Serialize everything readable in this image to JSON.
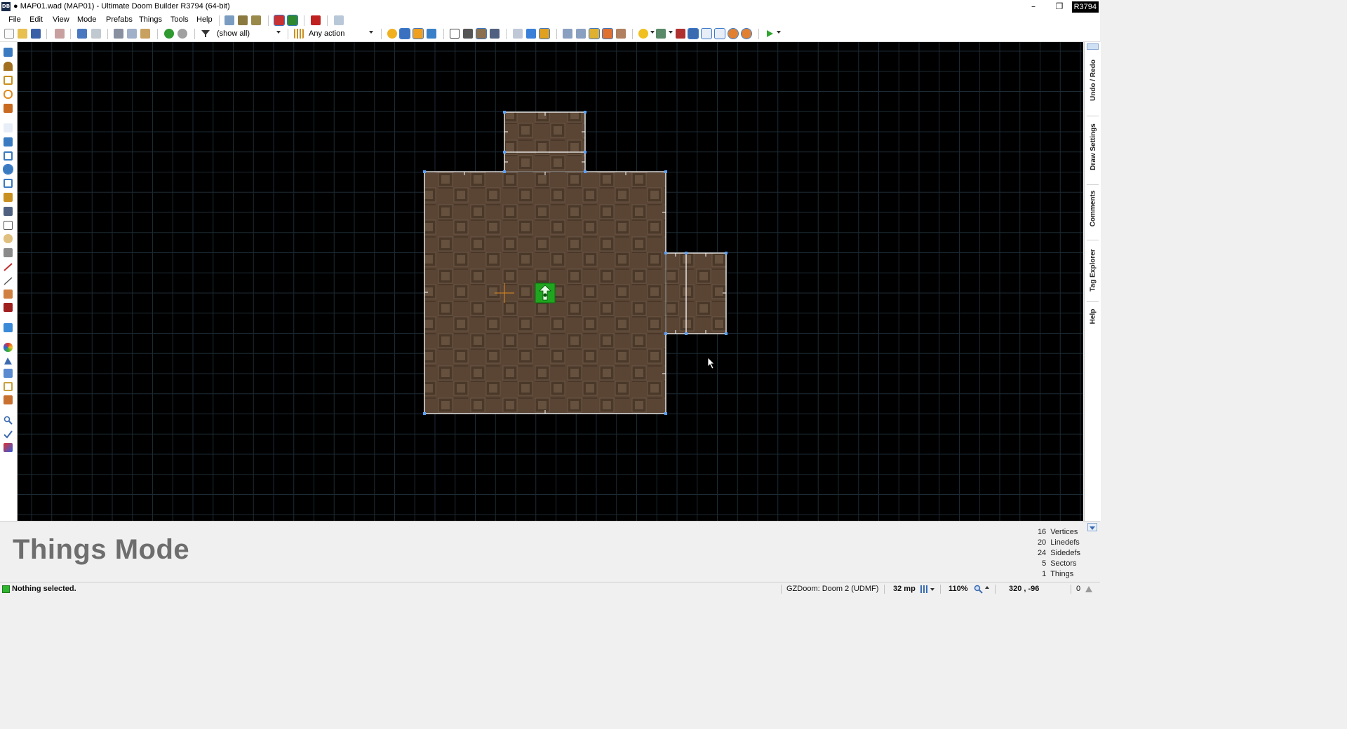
{
  "window": {
    "app_icon_text": "DB",
    "title": "● MAP01.wad (MAP01) - Ultimate Doom Builder R3794 (64-bit)",
    "revision_badge": "R3794",
    "minimize_glyph": "–",
    "restore_glyph": "❐",
    "close_glyph": "✕"
  },
  "menu": {
    "items": [
      "File",
      "Edit",
      "View",
      "Mode",
      "Prefabs",
      "Things",
      "Tools",
      "Help"
    ]
  },
  "toolbar": {
    "filter_value": "(show all)",
    "action_value": "Any action"
  },
  "dock": {
    "tabs": [
      "Undo / Redo",
      "Draw Settings",
      "Comments",
      "Tag Explorer",
      "Help"
    ]
  },
  "info_panel": {
    "mode_title": "Things Mode",
    "stats": [
      {
        "count": "16",
        "label": "Vertices"
      },
      {
        "count": "20",
        "label": "Linedefs"
      },
      {
        "count": "24",
        "label": "Sidedefs"
      },
      {
        "count": "5",
        "label": "Sectors"
      },
      {
        "count": "1",
        "label": "Things"
      }
    ]
  },
  "status": {
    "message": "Nothing selected.",
    "engine": "GZDoom: Doom 2 (UDMF)",
    "grid_size": "32 mp",
    "zoom": "110%",
    "coordinates": "320 , -96",
    "warnings": "0"
  },
  "colors": {
    "canvas_bg": "#000000",
    "grid_line": "#1c2a33",
    "floor_texture": "#5a4535",
    "linedef": "#ffffff",
    "vertex": "#5aa0ff",
    "thing": "#1fa51f",
    "crosshair": "#e08a1e"
  },
  "map": {
    "grid_unit_mp": 32,
    "thing": {
      "type": "player-1-start-icon"
    }
  }
}
